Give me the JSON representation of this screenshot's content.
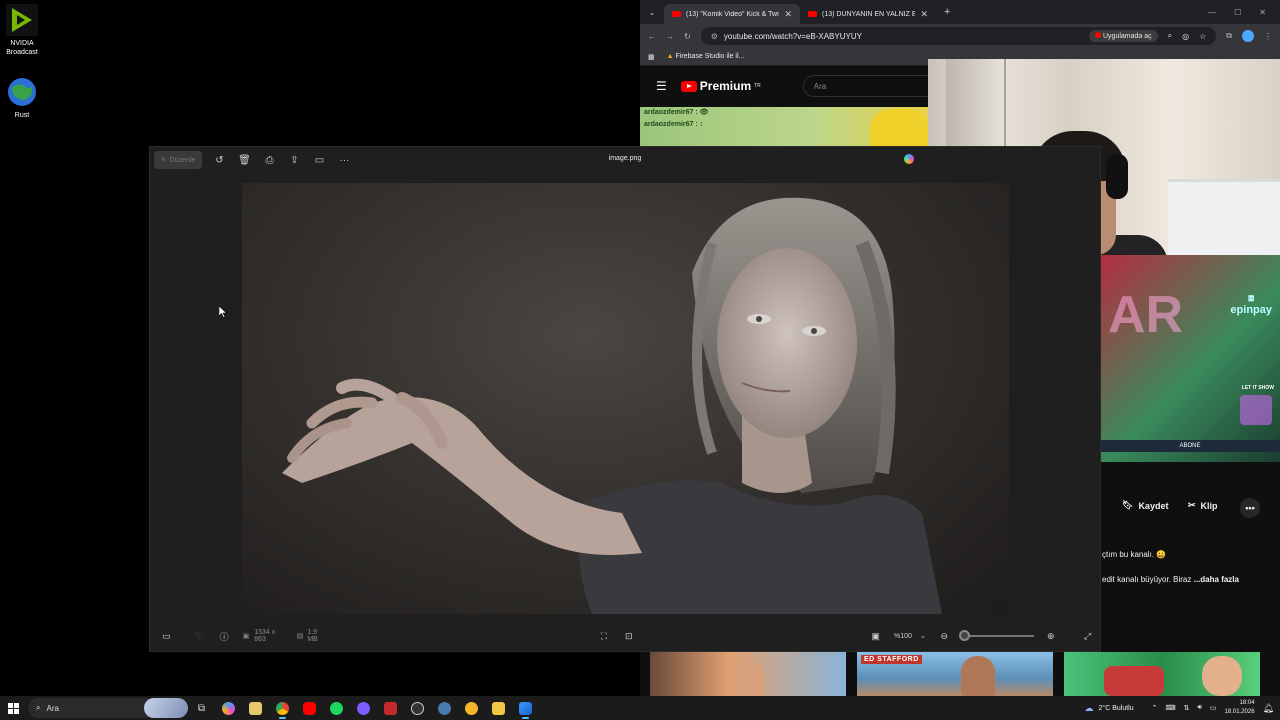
{
  "desktop": {
    "icons": [
      {
        "label_line1": "NVIDIA",
        "label_line2": "Broadcast",
        "icon": "nvidia-broadcast-icon"
      },
      {
        "label_line1": "Rust",
        "label_line2": "",
        "icon": "rust-game-icon"
      }
    ]
  },
  "browser": {
    "tabs": [
      {
        "label": "(13) \"Komik Video\" Kick & Twit",
        "icon": "youtube-icon",
        "active": true
      },
      {
        "label": "(13) DÜNYANIN EN YALNIZ EV",
        "icon": "youtube-icon",
        "active": false
      }
    ],
    "url": "youtube.com/watch?v=eB-XABYUYUY",
    "open_in_app": "Uygulamada aç",
    "bookmark": "Firebase Studio ile il...",
    "yt": {
      "logo": "Premium",
      "logo_sup": "TR",
      "search_placeholder": "Ara"
    },
    "chat": [
      {
        "user": "ardaozdemir67 :"
      },
      {
        "user": "ardaozdemir67 :"
      }
    ],
    "stream_overlay": {
      "big_text": "AR",
      "brand": "epinpay",
      "letitshow": "LET IT SHOW",
      "subscribe": "ABONE"
    },
    "actions": {
      "save": "Kaydet",
      "clip": "Klip"
    },
    "description": {
      "line1": "çtım bu kanalı. 😀",
      "line2": "edit kanalı büyüyor. Biraz",
      "more": "...daha fazla"
    },
    "thumbnails": [
      {
        "text": ""
      },
      {
        "text": "ED STAFFORD"
      },
      {
        "text": ""
      }
    ]
  },
  "viewer": {
    "title": "image.png",
    "edit_label": "Düzenle",
    "dimensions": "1534 x 863",
    "filesize": "1.9 MB",
    "zoom": "%100",
    "zoom_level": 0.05
  },
  "taskbar": {
    "search_placeholder": "Ara",
    "weather": "2°C  Bulutlu",
    "time": "18:04",
    "date": "18.01.2026"
  },
  "colors": {
    "accent": "#4cc2ff",
    "yt_red": "#ff0000"
  }
}
